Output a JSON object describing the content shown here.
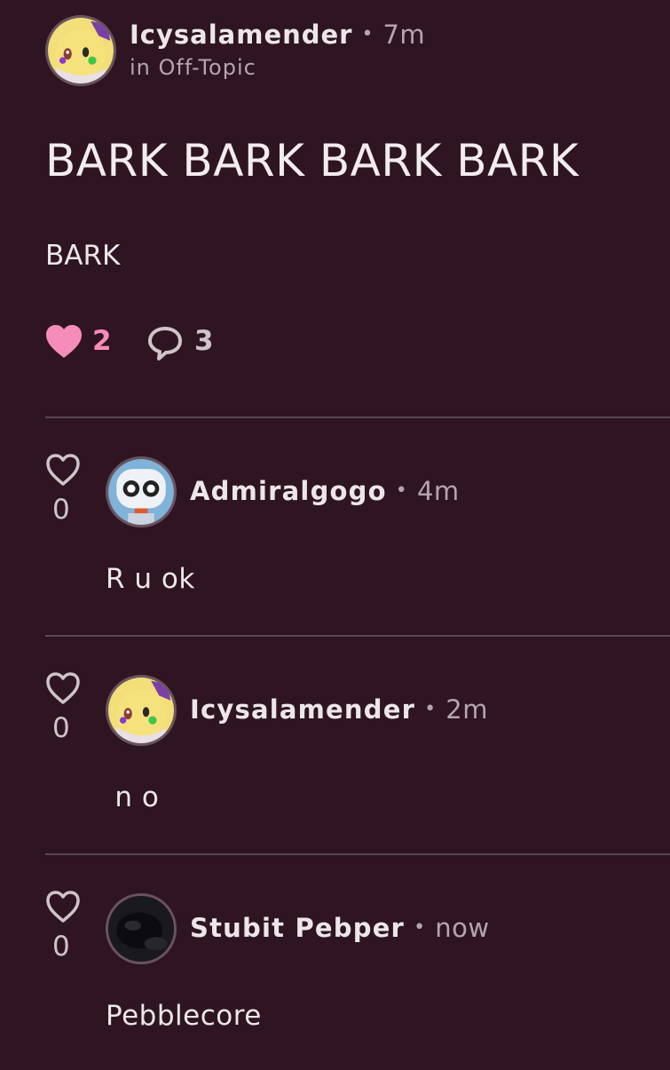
{
  "post": {
    "author": "Icysalamender",
    "dot": "•",
    "time": "7m",
    "topic": "in Off-Topic",
    "title": "BARK BARK BARK BARK",
    "body": "BARK",
    "likes": "2",
    "comments": "3"
  },
  "comments": [
    {
      "author": "Admiralgogo",
      "dot": "•",
      "time": "4m",
      "body": "R u ok",
      "likes": "0"
    },
    {
      "author": "Icysalamender",
      "dot": "•",
      "time": "2m",
      "body": " n o",
      "likes": "0"
    },
    {
      "author": "Stubit Pebper",
      "dot": "•",
      "time": "now",
      "body": "Pebblecore",
      "likes": "0"
    }
  ],
  "colors": {
    "background": "#2e1521",
    "liked_heart": "#f68cb9",
    "muted_text": "#b6a4ae",
    "divider": "#5a4752"
  }
}
